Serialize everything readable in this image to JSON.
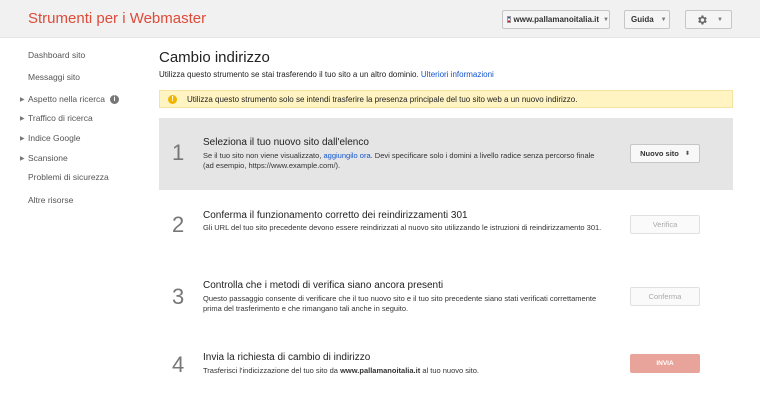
{
  "header": {
    "app_title": "Strumenti per i Webmaster",
    "site_selector": "www.pallamanoitalia.it",
    "help_label": "Guida"
  },
  "sidebar": {
    "items": [
      {
        "label": "Dashboard sito",
        "expandable": false
      },
      {
        "label": "Messaggi sito",
        "expandable": false
      },
      {
        "label": "Aspetto nella ricerca",
        "expandable": true
      },
      {
        "label": "Traffico di ricerca",
        "expandable": true
      },
      {
        "label": "Indice Google",
        "expandable": true
      },
      {
        "label": "Scansione",
        "expandable": true
      },
      {
        "label": "Problemi di sicurezza",
        "expandable": false
      },
      {
        "label": "Altre risorse",
        "expandable": false
      }
    ]
  },
  "main": {
    "title": "Cambio indirizzo",
    "intro_text": "Utilizza questo strumento se stai trasferendo il tuo sito a un altro dominio.",
    "intro_link": "Ulteriori informazioni",
    "warning": "Utilizza questo strumento solo se intendi trasferire la presenza principale del tuo sito web a un nuovo indirizzo.",
    "steps": [
      {
        "number": "1",
        "title": "Seleziona il tuo nuovo sito dall'elenco",
        "desc_pre": "Se il tuo sito non viene visualizzato,",
        "desc_link": "aggiungilo ora",
        "desc_post": ". Devi specificare solo i domini a livello radice senza percorso finale (ad esempio, https://www.example.com/).",
        "button": "Nuovo sito"
      },
      {
        "number": "2",
        "title": "Conferma il funzionamento corretto dei reindirizzamenti 301",
        "desc": "Gli URL del tuo sito precedente devono essere reindirizzati al nuovo sito utilizzando le istruzioni di reindirizzamento 301.",
        "button": "Verifica"
      },
      {
        "number": "3",
        "title": "Controlla che i metodi di verifica siano ancora presenti",
        "desc": "Questo passaggio consente di verificare che il tuo nuovo sito e il tuo sito precedente siano stati verificati correttamente prima del trasferimento e che rimangano tali anche in seguito.",
        "button": "Conferma"
      },
      {
        "number": "4",
        "title": "Invia la richiesta di cambio di indirizzo",
        "desc_pre": "Trasferisci l'indicizzazione del tuo sito da",
        "desc_bold": "www.pallamanoitalia.it",
        "desc_post": "al tuo nuovo sito.",
        "button": "INVIA"
      }
    ]
  },
  "colors": {
    "brand_red": "#dd4b39",
    "link_blue": "#1155cc",
    "warning_bg": "#fff4c2",
    "send_button": "#e8a39a"
  }
}
